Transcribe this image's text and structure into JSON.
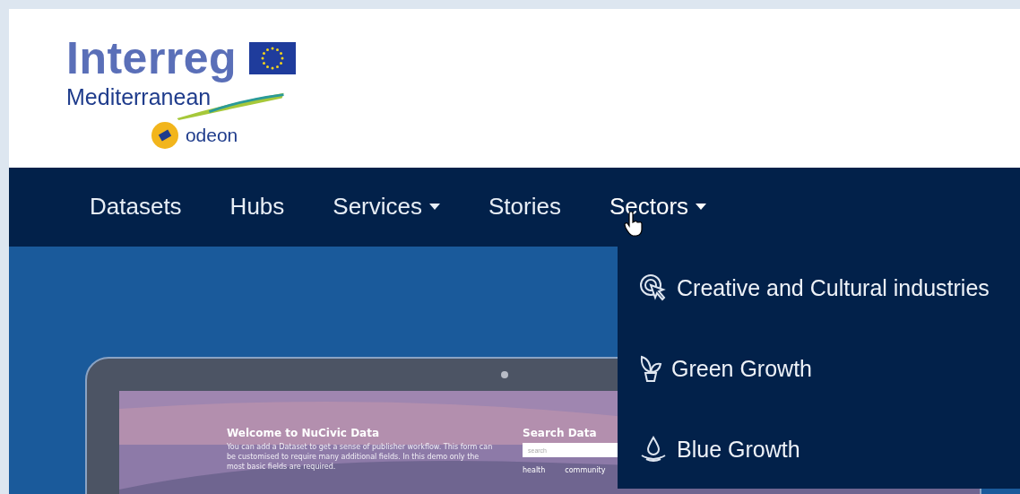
{
  "logo": {
    "title": "Interreg",
    "region": "Mediterranean",
    "project": "odeon"
  },
  "nav": [
    {
      "label": "Datasets",
      "dropdown": false,
      "expanded": false
    },
    {
      "label": "Hubs",
      "dropdown": false,
      "expanded": false
    },
    {
      "label": "Services",
      "dropdown": true,
      "expanded": false
    },
    {
      "label": "Stories",
      "dropdown": false,
      "expanded": false
    },
    {
      "label": "Sectors",
      "dropdown": true,
      "expanded": true
    }
  ],
  "sectors_menu": [
    {
      "label": "Creative and Cultural industries"
    },
    {
      "label": "Green Growth"
    },
    {
      "label": "Blue Growth"
    }
  ],
  "preview": {
    "title": "Welcome to NuCivic Data",
    "text": "You can add a Dataset to get a sense of publisher workflow. This form can be customised to require many additional fields. In this demo only the most basic fields are required.",
    "search_title": "Search Data",
    "search_placeholder": "search",
    "tags": [
      "health",
      "community"
    ]
  }
}
